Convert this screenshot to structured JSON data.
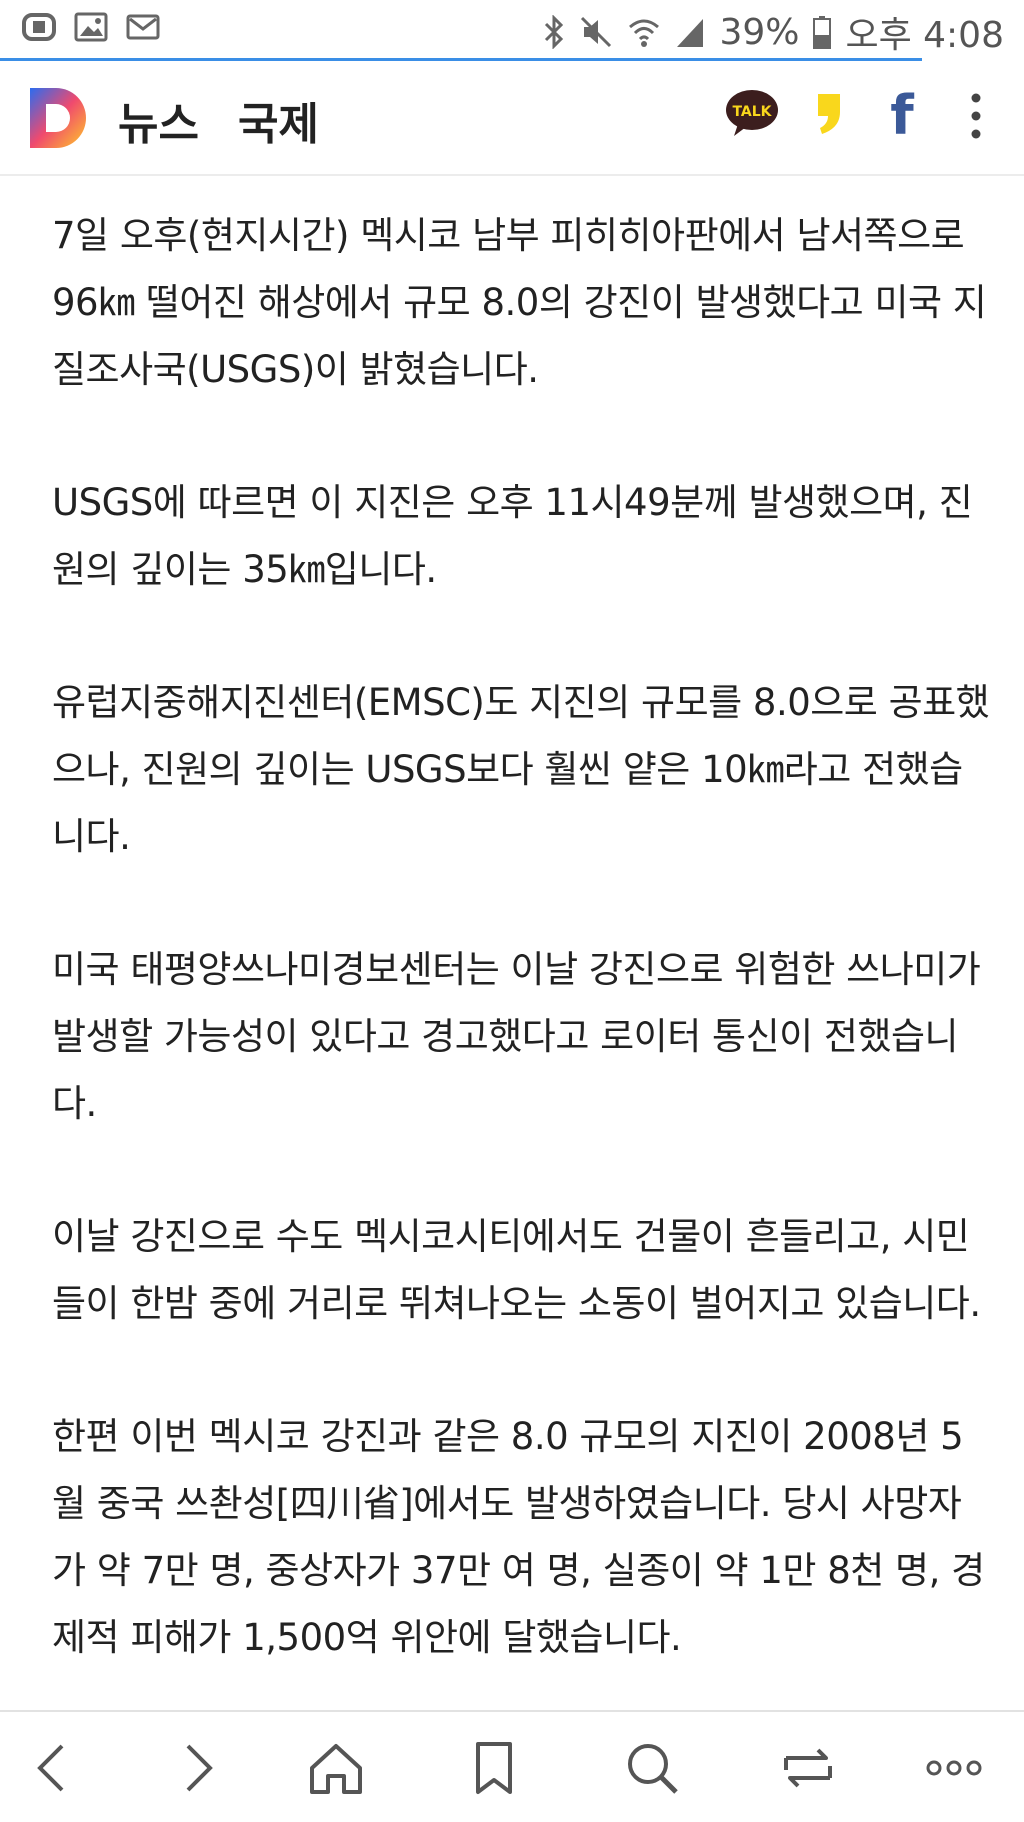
{
  "status_bar": {
    "battery": "39%",
    "time": "오후 4:08"
  },
  "header": {
    "section": "뉴스",
    "category": "국제",
    "share_icons": [
      "kakaotalk-icon",
      "kakaostory-icon",
      "facebook-icon",
      "more-icon"
    ],
    "talk_label": "TALK",
    "facebook_label": "f"
  },
  "article": {
    "paragraphs": [
      "7일 오후(현지시간) 멕시코 남부 피히히아판에서 남서쪽으로 96㎞ 떨어진 해상에서 규모 8.0의 강진이 발생했다고 미국 지질조사국(USGS)이 밝혔습니다.",
      "USGS에 따르면 이 지진은 오후 11시49분께 발생했으며, 진원의 깊이는 35㎞입니다.",
      "유럽지중해지진센터(EMSC)도 지진의 규모를 8.0으로 공표했으나, 진원의 깊이는 USGS보다 훨씬 얕은 10㎞라고 전했습니다.",
      "미국 태평양쓰나미경보센터는 이날 강진으로 위험한 쓰나미가 발생할 가능성이 있다고 경고했다고 로이터 통신이 전했습니다.",
      "이날 강진으로 수도 멕시코시티에서도 건물이 흔들리고, 시민들이 한밤 중에 거리로 뛰쳐나오는 소동이 벌어지고 있습니다.",
      "한편 이번 멕시코 강진과 같은 8.0 규모의 지진이 2008년 5월 중국 쓰촨성[四川省]에서도 발생하였습니다. 당시 사망자가 약 7만 명, 중상자가 37만 여 명, 실종이 약 1만 8천 명, 경제적 피해가 1,500억 위안에 달했습니다."
    ]
  },
  "bottom_nav": {
    "items": [
      "back-icon",
      "forward-icon",
      "home-icon",
      "bookmark-icon",
      "search-icon",
      "tabs-icon",
      "more-icon"
    ]
  },
  "colors": {
    "accent_blue": "#3a8ee6",
    "kakao_brown": "#3c1e1e",
    "kakao_yellow": "#f9d71c",
    "facebook_blue": "#3b5998"
  }
}
